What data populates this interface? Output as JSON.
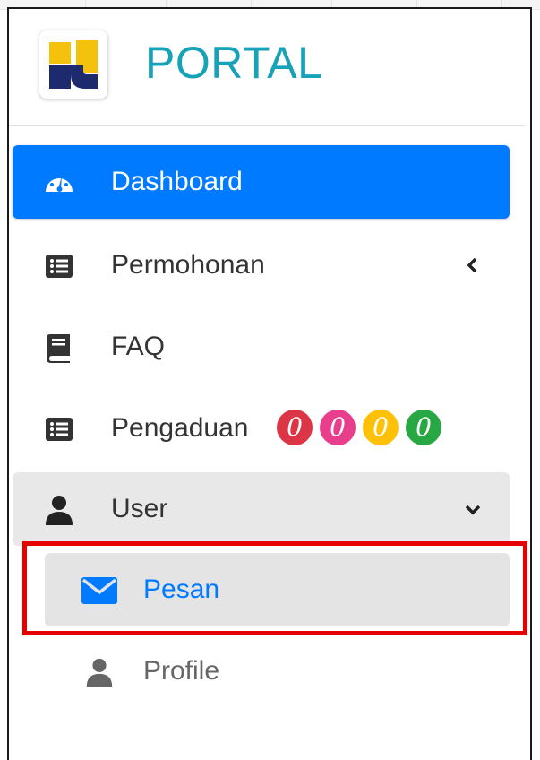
{
  "brand": {
    "title": "PORTAL",
    "logo_icon": "pupr-logo-icon"
  },
  "nav": {
    "dashboard": {
      "label": "Dashboard",
      "icon": "tachometer-icon"
    },
    "permohonan": {
      "label": "Permohonan",
      "icon": "list-alt-icon",
      "chevron": "chevron-left-icon"
    },
    "faq": {
      "label": "FAQ",
      "icon": "book-icon"
    },
    "pengaduan": {
      "label": "Pengaduan",
      "icon": "list-alt-icon",
      "badges": [
        {
          "value": "0",
          "color": "#dc3545"
        },
        {
          "value": "0",
          "color": "#e83e8c"
        },
        {
          "value": "0",
          "color": "#ffc107"
        },
        {
          "value": "0",
          "color": "#28a745"
        }
      ]
    },
    "user": {
      "label": "User",
      "icon": "user-icon",
      "chevron": "chevron-down-icon"
    }
  },
  "submenu": {
    "pesan": {
      "label": "Pesan",
      "icon": "envelope-icon"
    },
    "profile": {
      "label": "Profile",
      "icon": "user-icon"
    }
  },
  "colors": {
    "primary": "#007bff",
    "brand_text": "#17a2b8",
    "highlight": "#e60000"
  }
}
